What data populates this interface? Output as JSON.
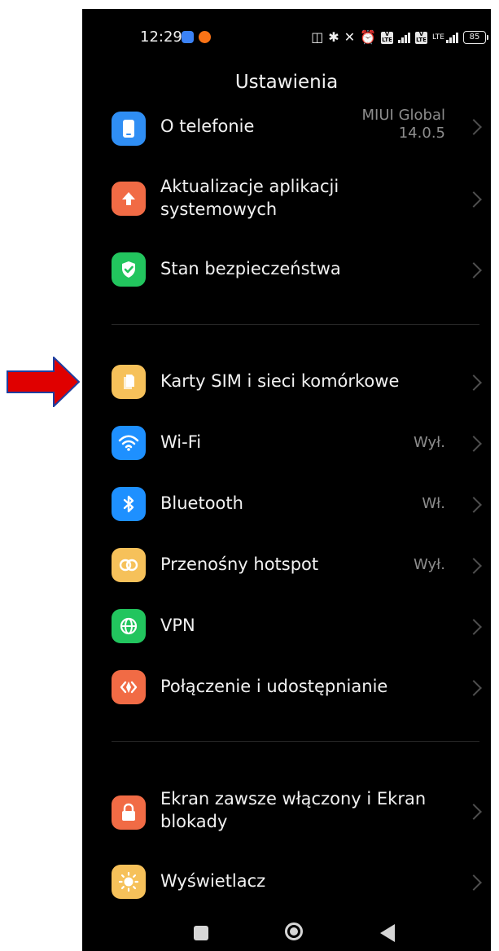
{
  "status_bar": {
    "time": "12:29",
    "battery": "85",
    "network": "LTE"
  },
  "header": {
    "title": "Ustawienia"
  },
  "settings": {
    "items": [
      {
        "label": "O telefonie",
        "value_line1": "MIUI Global",
        "value_line2": "14.0.5",
        "icon": "phone-icon",
        "color": "#2f8ef4"
      },
      {
        "label_line1": "Aktualizacje aplikacji",
        "label_line2": "systemowych",
        "icon": "arrow-up-icon",
        "color": "#f16b45"
      },
      {
        "label": "Stan bezpieczeństwa",
        "icon": "shield-check-icon",
        "color": "#22c55e"
      },
      {
        "label": "Karty SIM i sieci komórkowe",
        "icon": "sim-card-icon",
        "color": "#f6c15a"
      },
      {
        "label": "Wi-Fi",
        "value": "Wył.",
        "icon": "wifi-icon",
        "color": "#1e90ff"
      },
      {
        "label": "Bluetooth",
        "value": "Wł.",
        "icon": "bluetooth-icon",
        "color": "#1e90ff"
      },
      {
        "label": "Przenośny hotspot",
        "value": "Wył.",
        "icon": "hotspot-icon",
        "color": "#f6c15a"
      },
      {
        "label": "VPN",
        "icon": "globe-icon",
        "color": "#22c55e"
      },
      {
        "label": "Połączenie i udostępnianie",
        "icon": "share-icon",
        "color": "#f16b45"
      },
      {
        "label_line1": "Ekran zawsze włączony i Ekran",
        "label_line2": "blokady",
        "icon": "lock-icon",
        "color": "#f16b45"
      },
      {
        "label": "Wyświetlacz",
        "icon": "sun-icon",
        "color": "#f6c15a"
      }
    ]
  },
  "colors": {
    "background": "#000000",
    "annotation_arrow": "#e00000",
    "annotation_arrow_outline": "#1f3fa0"
  }
}
